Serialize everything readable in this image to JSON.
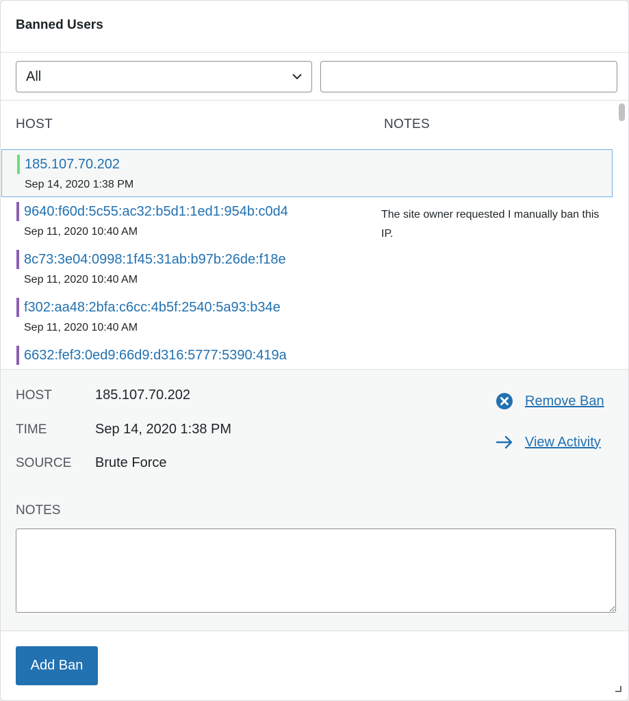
{
  "title": "Banned Users",
  "filter": {
    "selected": "All",
    "search_value": ""
  },
  "columns": {
    "host": "HOST",
    "notes": "NOTES"
  },
  "rows": [
    {
      "host": "185.107.70.202",
      "time": "Sep 14, 2020 1:38 PM",
      "note": "",
      "bar_color": "#68de7c",
      "selected": true
    },
    {
      "host": "9640:f60d:5c55:ac32:b5d1:1ed1:954b:c0d4",
      "time": "Sep 11, 2020 10:40 AM",
      "note": "The site owner requested I manually ban this IP.",
      "bar_color": "#8c5fb2",
      "selected": false
    },
    {
      "host": "8c73:3e04:0998:1f45:31ab:b97b:26de:f18e",
      "time": "Sep 11, 2020 10:40 AM",
      "note": "",
      "bar_color": "#8c5fb2",
      "selected": false
    },
    {
      "host": "f302:aa48:2bfa:c6cc:4b5f:2540:5a93:b34e",
      "time": "Sep 11, 2020 10:40 AM",
      "note": "",
      "bar_color": "#8c5fb2",
      "selected": false
    },
    {
      "host": "6632:fef3:0ed9:66d9:d316:5777:5390:419a",
      "time": "",
      "note": "",
      "bar_color": "#8c5fb2",
      "selected": false
    }
  ],
  "detail": {
    "host_label": "HOST",
    "host_value": "185.107.70.202",
    "time_label": "TIME",
    "time_value": "Sep 14, 2020 1:38 PM",
    "source_label": "SOURCE",
    "source_value": "Brute Force",
    "remove_label": "Remove Ban",
    "activity_label": "View Activity",
    "notes_label": "NOTES",
    "notes_value": ""
  },
  "footer": {
    "add_label": "Add Ban"
  },
  "colors": {
    "accent": "#2271b1",
    "selected_border": "#72aee6",
    "remove_icon": "#2271b1"
  },
  "icons": {
    "remove": "x-circle-icon",
    "activity": "arrow-right-icon",
    "dropdown": "chevron-down-icon",
    "resize": "resize-handle-icon"
  }
}
